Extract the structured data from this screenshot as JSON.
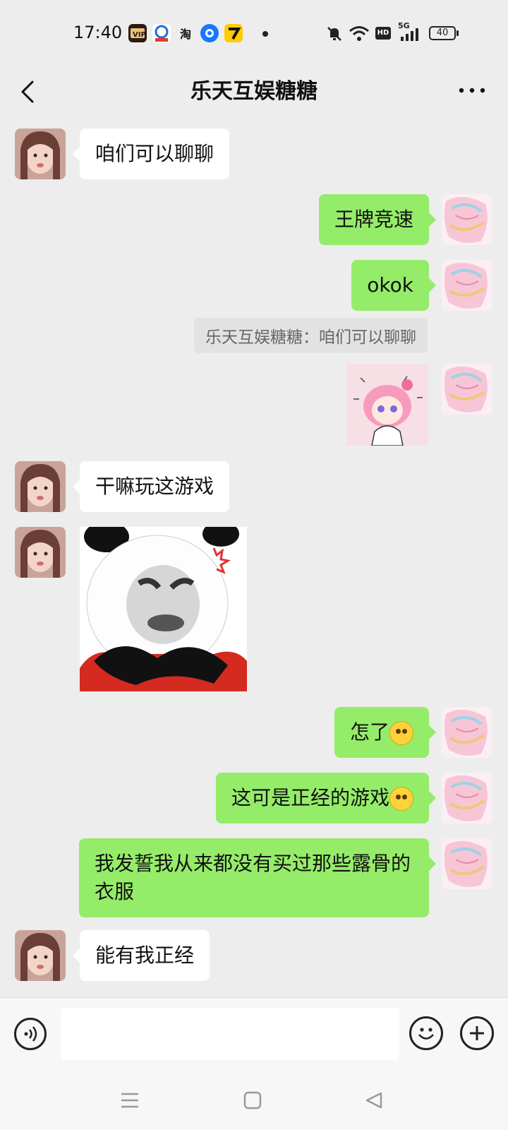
{
  "status_bar": {
    "time": "17:40",
    "icons": [
      "vip-app-icon",
      "bank-app-icon",
      "taobao-app-icon",
      "messenger-app-icon",
      "tiger-app-icon"
    ],
    "taobao_label": "淘",
    "network": "5G",
    "hd": "HD",
    "battery": "40"
  },
  "header": {
    "title": "乐天互娱糖糖",
    "back_icon": "chevron-left-icon",
    "more_icon": "more-dots-icon"
  },
  "messages": [
    {
      "side": "in",
      "type": "text",
      "text": "咱们可以聊聊"
    },
    {
      "side": "out",
      "type": "text",
      "text": "王牌竞速"
    },
    {
      "side": "out",
      "type": "text",
      "text": "okok"
    },
    {
      "side": "out",
      "type": "quote",
      "text": "乐天互娱糖糖：咱们可以聊聊"
    },
    {
      "side": "out",
      "type": "sticker",
      "sticker": "anime-girl-sticker"
    },
    {
      "side": "in",
      "type": "text",
      "text": "干嘛玩这游戏"
    },
    {
      "side": "in",
      "type": "sticker",
      "sticker": "angry-panda-meme"
    },
    {
      "side": "out",
      "type": "text",
      "text": "怎了"
    },
    {
      "side": "out",
      "type": "text",
      "text": "这可是正经的游戏"
    },
    {
      "side": "out",
      "type": "text",
      "text": "我发誓我从来都没有买过那些露骨的衣服"
    },
    {
      "side": "in",
      "type": "text",
      "text": "能有我正经"
    }
  ],
  "input_bar": {
    "voice_icon": "voice-icon",
    "emoji_icon": "emoji-icon",
    "plus_icon": "plus-icon",
    "value": ""
  },
  "nav_bar": {
    "icons": [
      "menu-icon",
      "home-icon",
      "back-icon"
    ]
  },
  "colors": {
    "background": "#EDEDED",
    "outgoing_bubble": "#95EC69",
    "incoming_bubble": "#FFFFFF"
  }
}
